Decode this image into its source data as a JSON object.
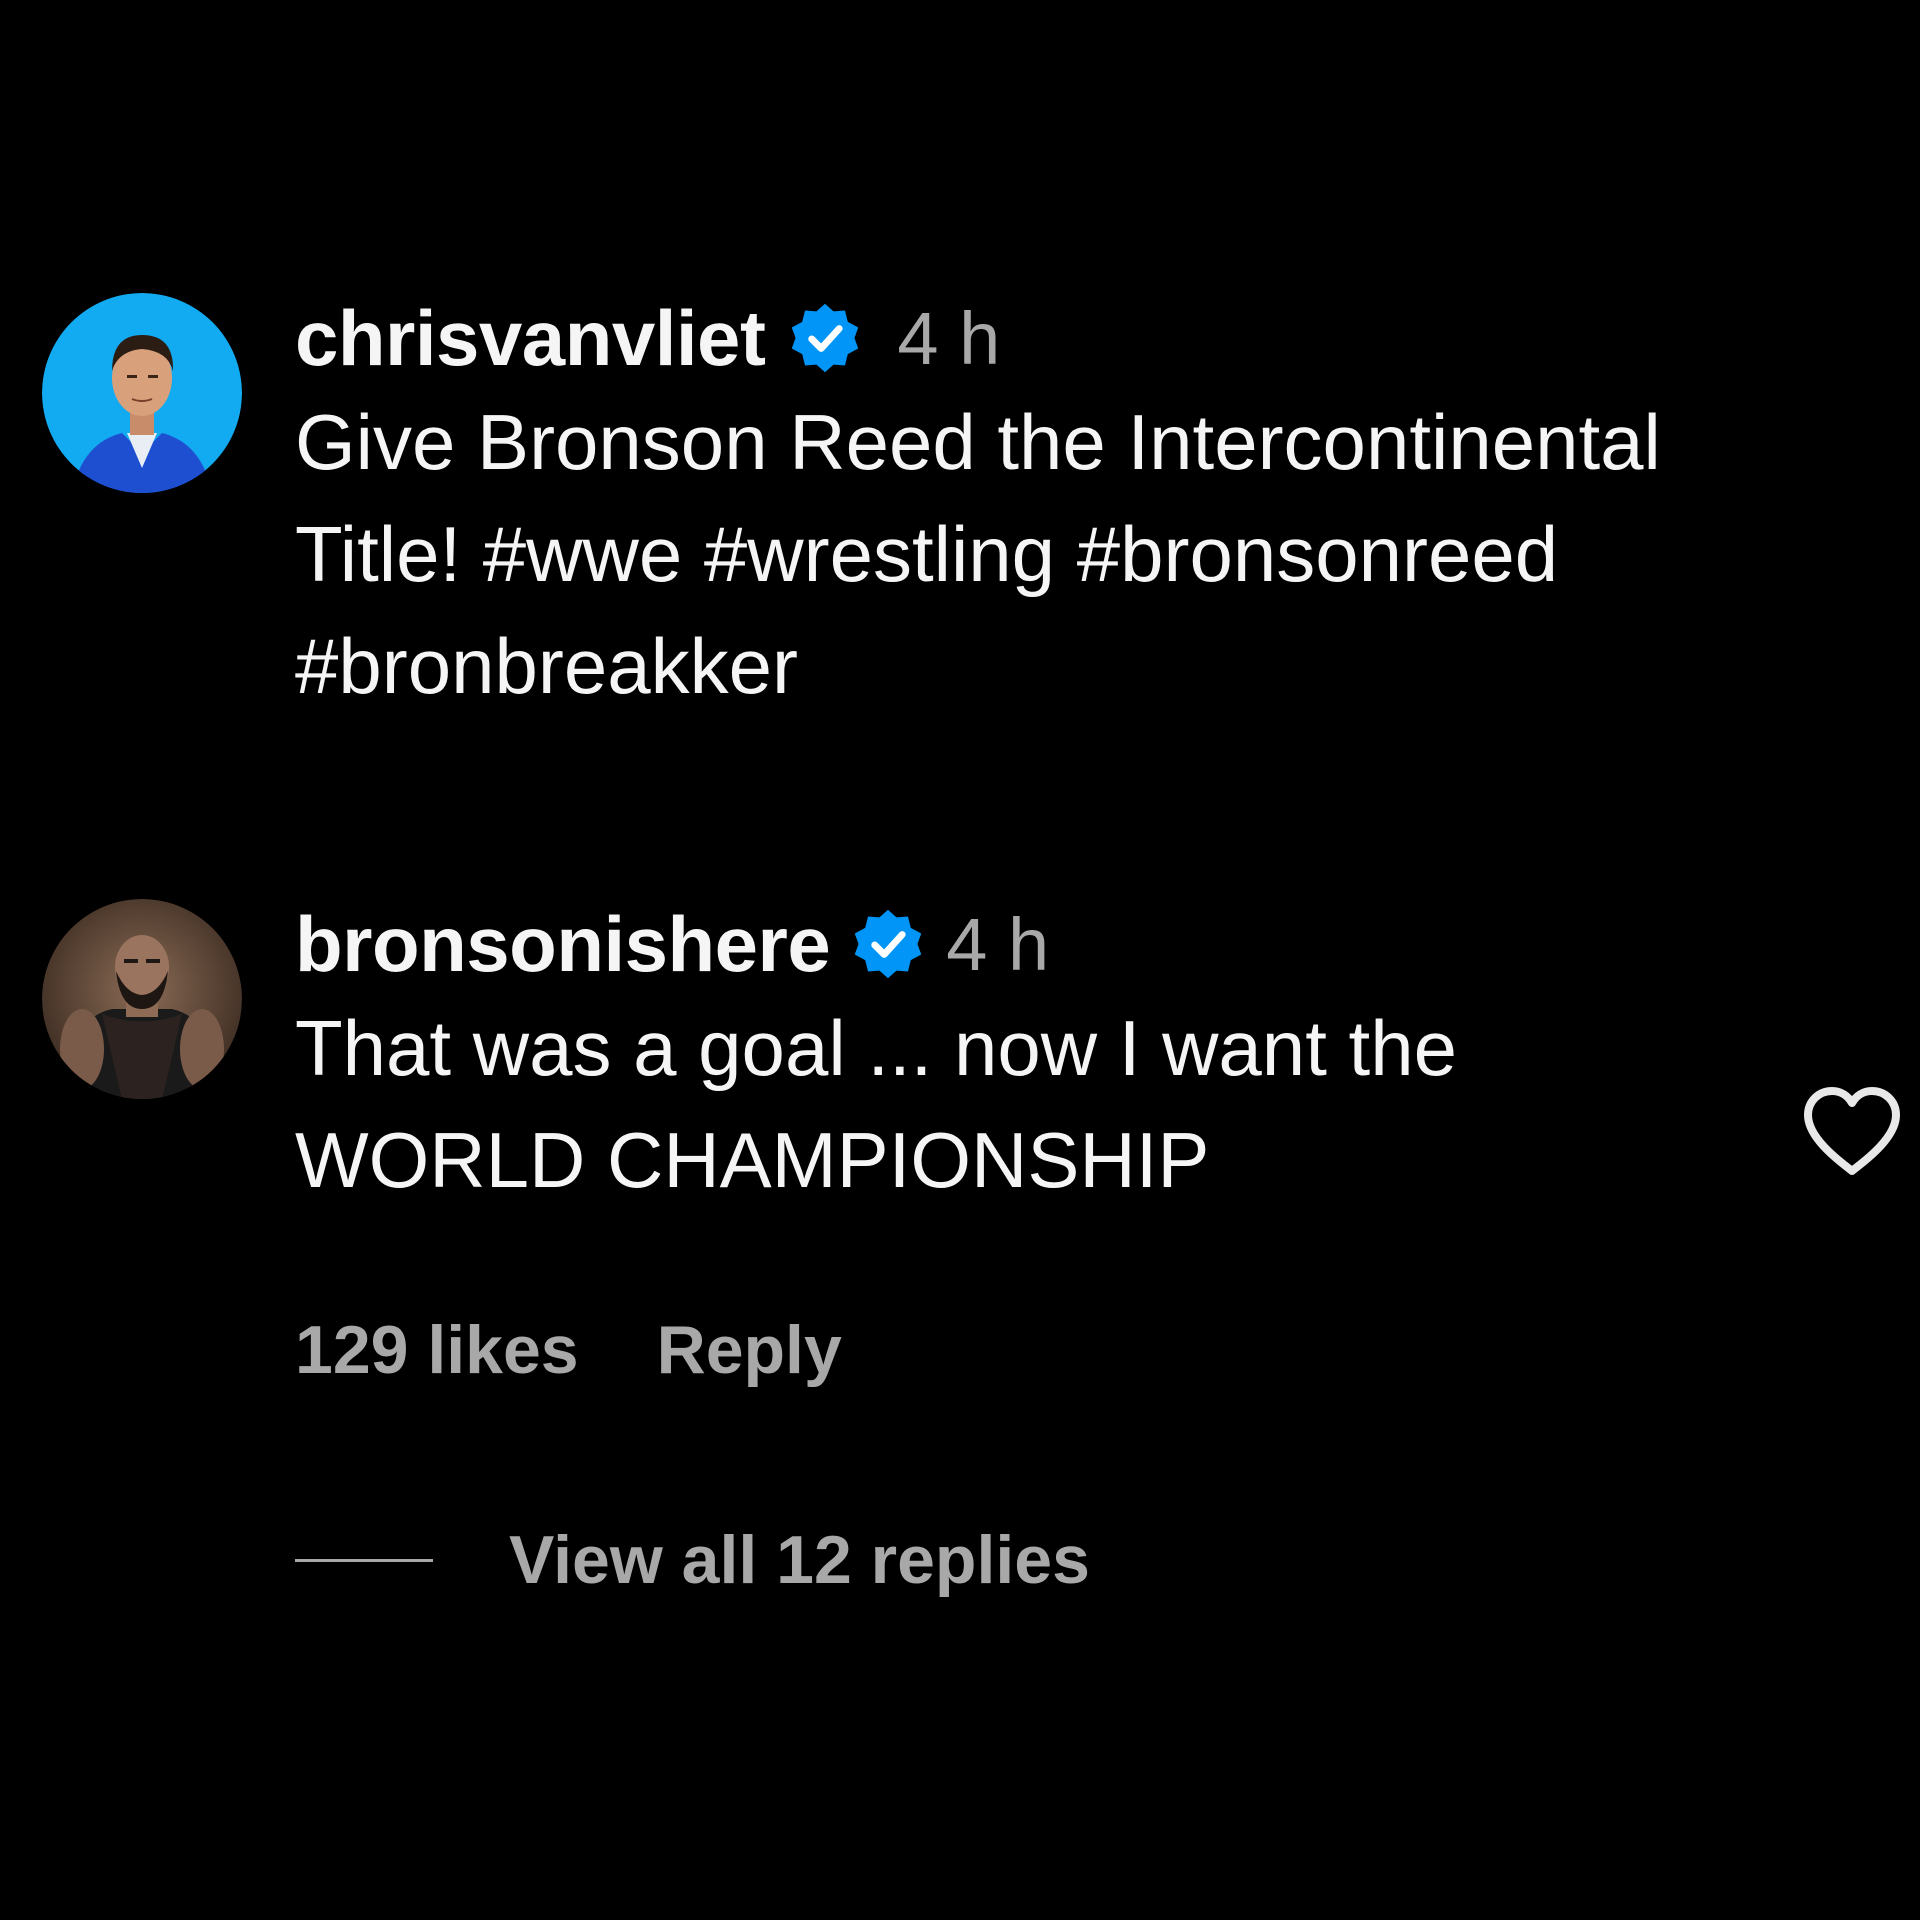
{
  "comments": [
    {
      "username": "chrisvanvliet",
      "verified": true,
      "time": "4 h",
      "text": "Give Bronson Reed the Intercontinental\nTitle! #wwe #wrestling #bronsonreed\n#bronbreakker",
      "avatar": "avatar-chrisvanvliet"
    },
    {
      "username": "bronsonishere",
      "verified": true,
      "time": "4 h",
      "text": "That was a goal ... now I want the\nWORLD CHAMPIONSHIP",
      "avatar": "avatar-bronsonishere",
      "likes": "129 likes",
      "reply_label": "Reply",
      "view_replies": "View all 12 replies",
      "like_icon": "heart-outline-icon"
    }
  ],
  "colors": {
    "background": "#000000",
    "text_primary": "#f5f5f5",
    "text_secondary": "#a8a8a8",
    "verified_blue": "#0095f6",
    "avatar1_bg": "#12aaf0"
  }
}
